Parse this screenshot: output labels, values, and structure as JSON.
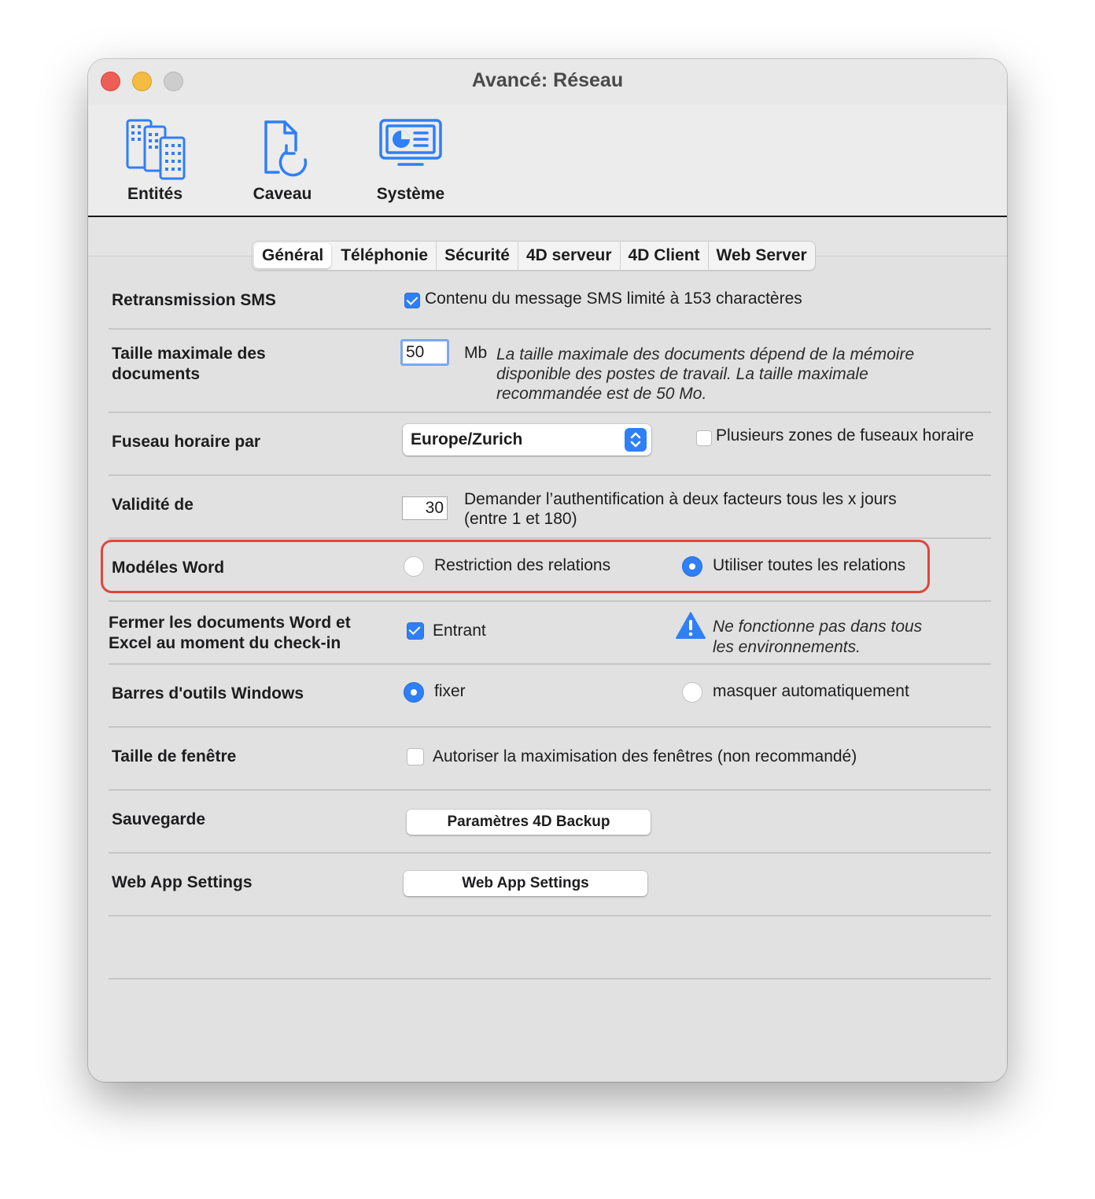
{
  "window": {
    "title": "Avancé: Réseau"
  },
  "toolbar": {
    "items": [
      {
        "label": "Entités",
        "icon": "buildings-icon"
      },
      {
        "label": "Caveau",
        "icon": "document-sync-icon"
      },
      {
        "label": "Système",
        "icon": "system-monitor-icon"
      }
    ]
  },
  "tabs": [
    {
      "label": "Général",
      "active": true
    },
    {
      "label": "Téléphonie"
    },
    {
      "label": "Sécurité"
    },
    {
      "label": "4D serveur"
    },
    {
      "label": "4D Client"
    },
    {
      "label": "Web Server"
    }
  ],
  "rows": {
    "sms": {
      "label": "Retransmission SMS",
      "checkbox_label": "Contenu du message SMS limité à 153 charactères",
      "checked": true
    },
    "docsize": {
      "label": "Taille maximale des documents",
      "value": "50",
      "unit": "Mb",
      "note": "La taille maximale des documents dépend de la mémoire disponible des postes de travail. La taille maximale recommandée est de 50 Mo."
    },
    "timezone": {
      "label": "Fuseau horaire par",
      "selected": "Europe/Zurich",
      "checkbox_label": "Plusieurs zones de fuseaux horaire",
      "checked": false
    },
    "validity": {
      "label": "Validité de",
      "value": "30",
      "note_line1": "Demander l’authentification à deux facteurs tous les x jours",
      "note_line2": "(entre 1 et 180)"
    },
    "word": {
      "label": "Modéles Word",
      "option1": "Restriction des relations",
      "option2": "Utiliser toutes les relations",
      "selected": "option2"
    },
    "close_docs": {
      "label_line1": "Fermer les documents Word et",
      "label_line2": "Excel au moment du check-in",
      "checkbox_label": "Entrant",
      "checked": true,
      "warning_line1": "Ne fonctionne pas dans tous",
      "warning_line2": "les environnements."
    },
    "toolbars": {
      "label": "Barres d'outils Windows",
      "option1": "fixer",
      "option2": "masquer automatiquement",
      "selected": "option1"
    },
    "window_size": {
      "label": "Taille de fenêtre",
      "checkbox_label": "Autoriser la maximisation des fenêtres (non recommandé)",
      "checked": false
    },
    "backup": {
      "label": "Sauvegarde",
      "button": "Paramètres 4D Backup"
    },
    "webapp": {
      "label": "Web App Settings",
      "button": "Web App Settings"
    }
  },
  "colors": {
    "accent": "#2f7ff6",
    "highlight": "#e0463a"
  }
}
